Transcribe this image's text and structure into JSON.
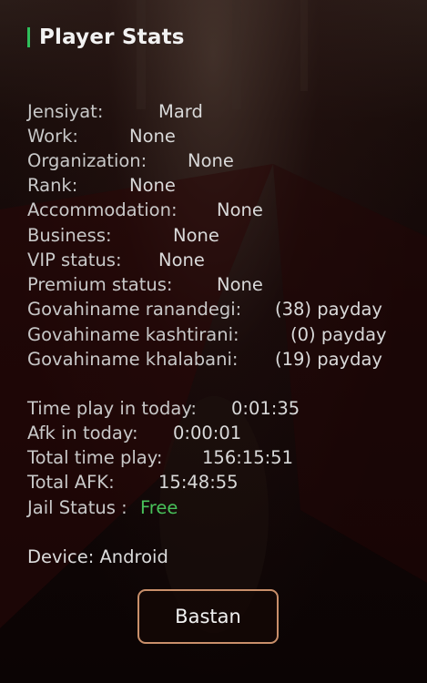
{
  "panel": {
    "title": "Player Stats"
  },
  "stats": [
    {
      "label": "Jensiyat:",
      "value": "Mard"
    },
    {
      "label": "Work:",
      "value": "None"
    },
    {
      "label": "Organization:",
      "value": "None"
    },
    {
      "label": "Rank:",
      "value": "None"
    },
    {
      "label": "Accommodation:",
      "value": "None"
    },
    {
      "label": "Business:",
      "value": "None"
    },
    {
      "label": "VIP status:",
      "value": "None"
    },
    {
      "label": "Premium status:",
      "value": "None"
    },
    {
      "label": "Govahiname ranandegi:",
      "value": "(38) payday"
    },
    {
      "label": "Govahiname kashtirani:",
      "value": "(0) payday"
    },
    {
      "label": "Govahiname khalabani:",
      "value": "(19) payday"
    }
  ],
  "time": [
    {
      "label": "Time play in today:",
      "value": "0:01:35"
    },
    {
      "label": "Afk in today:",
      "value": "0:00:01"
    },
    {
      "label": "Total time play:",
      "value": "156:15:51"
    },
    {
      "label": "Total AFK:",
      "value": "15:48:55"
    }
  ],
  "jail": {
    "label": "Jail Status :",
    "value": "Free"
  },
  "device": {
    "text": "Device: Android"
  },
  "close_button": {
    "label": "Bastan"
  },
  "colors": {
    "accent": "#2fbf5b",
    "free": "#48c25a",
    "button_border": "#c98f6a"
  }
}
